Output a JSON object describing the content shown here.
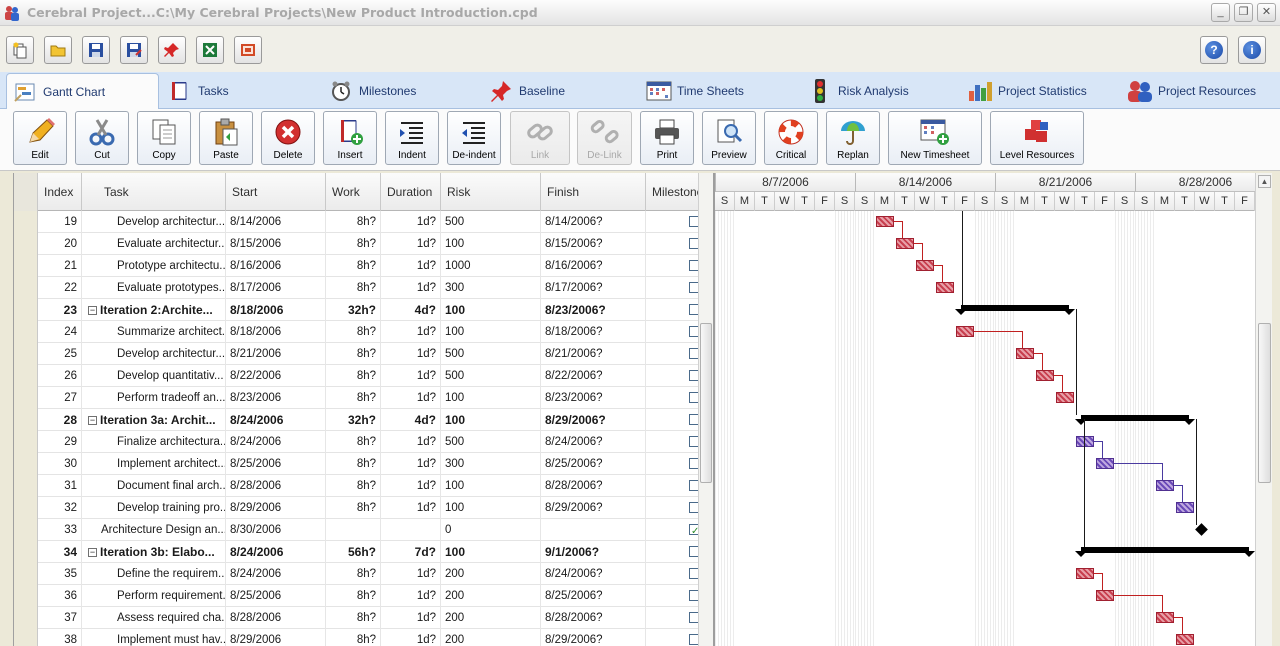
{
  "window": {
    "title": "Cerebral Project...C:\\My Cerebral Projects\\New Product Introduction.cpd",
    "minimize": "_",
    "maximize": "❐",
    "close": "✕"
  },
  "quickbar": {
    "help_label": "?",
    "info_label": "i"
  },
  "tabs": [
    {
      "label": "Gantt Chart"
    },
    {
      "label": "Tasks"
    },
    {
      "label": "Milestones"
    },
    {
      "label": "Baseline"
    },
    {
      "label": "Time Sheets"
    },
    {
      "label": "Risk Analysis"
    },
    {
      "label": "Project Statistics"
    },
    {
      "label": "Project Resources"
    }
  ],
  "ribbon": [
    {
      "label": "Edit"
    },
    {
      "label": "Cut"
    },
    {
      "label": "Copy"
    },
    {
      "label": "Paste"
    },
    {
      "label": "Delete"
    },
    {
      "label": "Insert"
    },
    {
      "label": "Indent"
    },
    {
      "label": "De-indent"
    },
    {
      "label": "Link"
    },
    {
      "label": "De-Link"
    },
    {
      "label": "Print"
    },
    {
      "label": "Preview"
    },
    {
      "label": "Critical"
    },
    {
      "label": "Replan"
    },
    {
      "label": "New Timesheet"
    },
    {
      "label": "Level Resources"
    }
  ],
  "grid": {
    "columns": [
      "Index",
      "Task",
      "Start",
      "Work",
      "Duration",
      "Risk",
      "Finish",
      "Milestone"
    ],
    "rows": [
      {
        "index": "19",
        "task": "Develop architectur...",
        "start": "8/14/2006",
        "work": "8h?",
        "duration": "1d?",
        "risk": "500",
        "finish": "8/14/2006?",
        "summary": false,
        "indent": 2,
        "milestone": false
      },
      {
        "index": "20",
        "task": "Evaluate architectur...",
        "start": "8/15/2006",
        "work": "8h?",
        "duration": "1d?",
        "risk": "100",
        "finish": "8/15/2006?",
        "summary": false,
        "indent": 2,
        "milestone": false
      },
      {
        "index": "21",
        "task": "Prototype architectu...",
        "start": "8/16/2006",
        "work": "8h?",
        "duration": "1d?",
        "risk": "1000",
        "finish": "8/16/2006?",
        "summary": false,
        "indent": 2,
        "milestone": false
      },
      {
        "index": "22",
        "task": "Evaluate prototypes...",
        "start": "8/17/2006",
        "work": "8h?",
        "duration": "1d?",
        "risk": "300",
        "finish": "8/17/2006?",
        "summary": false,
        "indent": 2,
        "milestone": false
      },
      {
        "index": "23",
        "task": "Iteration 2:Archite...",
        "start": "8/18/2006",
        "work": "32h?",
        "duration": "4d?",
        "risk": "100",
        "finish": "8/23/2006?",
        "summary": true,
        "indent": 1,
        "milestone": false
      },
      {
        "index": "24",
        "task": "Summarize architect...",
        "start": "8/18/2006",
        "work": "8h?",
        "duration": "1d?",
        "risk": "100",
        "finish": "8/18/2006?",
        "summary": false,
        "indent": 2,
        "milestone": false
      },
      {
        "index": "25",
        "task": "Develop architectur...",
        "start": "8/21/2006",
        "work": "8h?",
        "duration": "1d?",
        "risk": "500",
        "finish": "8/21/2006?",
        "summary": false,
        "indent": 2,
        "milestone": false
      },
      {
        "index": "26",
        "task": "Develop quantitativ...",
        "start": "8/22/2006",
        "work": "8h?",
        "duration": "1d?",
        "risk": "500",
        "finish": "8/22/2006?",
        "summary": false,
        "indent": 2,
        "milestone": false
      },
      {
        "index": "27",
        "task": "Perform tradeoff an...",
        "start": "8/23/2006",
        "work": "8h?",
        "duration": "1d?",
        "risk": "100",
        "finish": "8/23/2006?",
        "summary": false,
        "indent": 2,
        "milestone": false
      },
      {
        "index": "28",
        "task": "Iteration 3a: Archit...",
        "start": "8/24/2006",
        "work": "32h?",
        "duration": "4d?",
        "risk": "100",
        "finish": "8/29/2006?",
        "summary": true,
        "indent": 1,
        "milestone": false
      },
      {
        "index": "29",
        "task": "Finalize architectura...",
        "start": "8/24/2006",
        "work": "8h?",
        "duration": "1d?",
        "risk": "500",
        "finish": "8/24/2006?",
        "summary": false,
        "indent": 2,
        "milestone": false
      },
      {
        "index": "30",
        "task": "Implement architect...",
        "start": "8/25/2006",
        "work": "8h?",
        "duration": "1d?",
        "risk": "300",
        "finish": "8/25/2006?",
        "summary": false,
        "indent": 2,
        "milestone": false
      },
      {
        "index": "31",
        "task": "Document final arch...",
        "start": "8/28/2006",
        "work": "8h?",
        "duration": "1d?",
        "risk": "100",
        "finish": "8/28/2006?",
        "summary": false,
        "indent": 2,
        "milestone": false
      },
      {
        "index": "32",
        "task": "Develop training pro...",
        "start": "8/29/2006",
        "work": "8h?",
        "duration": "1d?",
        "risk": "100",
        "finish": "8/29/2006?",
        "summary": false,
        "indent": 2,
        "milestone": false
      },
      {
        "index": "33",
        "task": "Architecture Design an...",
        "start": "8/30/2006",
        "work": "",
        "duration": "",
        "risk": "0",
        "finish": "",
        "summary": false,
        "indent": 1,
        "milestone": true
      },
      {
        "index": "34",
        "task": "Iteration 3b: Elabo...",
        "start": "8/24/2006",
        "work": "56h?",
        "duration": "7d?",
        "risk": "100",
        "finish": "9/1/2006?",
        "summary": true,
        "indent": 1,
        "milestone": false
      },
      {
        "index": "35",
        "task": "Define the requirem...",
        "start": "8/24/2006",
        "work": "8h?",
        "duration": "1d?",
        "risk": "200",
        "finish": "8/24/2006?",
        "summary": false,
        "indent": 2,
        "milestone": false
      },
      {
        "index": "36",
        "task": "Perform requirement...",
        "start": "8/25/2006",
        "work": "8h?",
        "duration": "1d?",
        "risk": "200",
        "finish": "8/25/2006?",
        "summary": false,
        "indent": 2,
        "milestone": false
      },
      {
        "index": "37",
        "task": "Assess required cha...",
        "start": "8/28/2006",
        "work": "8h?",
        "duration": "1d?",
        "risk": "200",
        "finish": "8/28/2006?",
        "summary": false,
        "indent": 2,
        "milestone": false
      },
      {
        "index": "38",
        "task": "Implement must hav...",
        "start": "8/29/2006",
        "work": "8h?",
        "duration": "1d?",
        "risk": "200",
        "finish": "8/29/2006?",
        "summary": false,
        "indent": 2,
        "milestone": false
      }
    ]
  },
  "gantt": {
    "weeks": [
      "8/7/2006",
      "8/14/2006",
      "8/21/2006",
      "8/28/2006"
    ],
    "day_letters": [
      "S",
      "M",
      "T",
      "W",
      "T",
      "F",
      "S"
    ]
  },
  "colors": {
    "task_bar": "#c84050",
    "critical_bar": "#6a4ab8",
    "summary_bar": "#000000",
    "tab_bar": "#d8e6f7"
  }
}
